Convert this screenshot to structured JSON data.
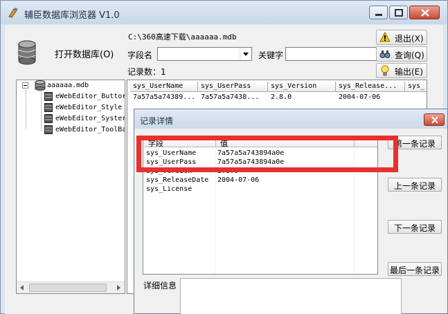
{
  "window": {
    "title": "辅臣数据库浏览器 V1.0"
  },
  "toolbar": {
    "open_db_label": "打开数据库(O)",
    "db_path": "C:\\360高速下载\\aaaaaa.mdb",
    "field_label": "字段名",
    "field_value": "",
    "keyword_label": "关键字",
    "keyword_value": "",
    "record_count_label": "记录数：1",
    "exit_label": "退出(X)",
    "query_label": "查询(Q)",
    "output_label": "输出(E)"
  },
  "tree": {
    "root": "aaaaaa.mdb",
    "tables": [
      "eWebEditor_Button",
      "eWebEditor_Style",
      "eWebEditor_System",
      "eWebEditor_ToolBar"
    ],
    "tables_display": [
      "eWebEditor_Buttor",
      "eWebEditor_Style",
      "eWebEditor_Syster",
      "eWebEditor_ToolBa"
    ]
  },
  "grid": {
    "columns": [
      "sys_UserName",
      "sys_UserPass",
      "sys_Version",
      "sys_Release...",
      "sys_"
    ],
    "rows": [
      [
        "7a57a5a74389...",
        "7a57a5a7438...",
        "2.8.0",
        "2004-07-06",
        ""
      ]
    ]
  },
  "dialog": {
    "title": "记录详情",
    "col_field": "字段",
    "col_value": "值",
    "rows": [
      {
        "field": "sys_UserName",
        "value": "7a57a5a743894a0e"
      },
      {
        "field": "sys_UserPass",
        "value": "7a57a5a743894a0e"
      },
      {
        "field": "sys_Version",
        "value": "2.8.0"
      },
      {
        "field": "sys_ReleaseDate",
        "value": "2004-07-06"
      },
      {
        "field": "sys_License",
        "value": ""
      }
    ],
    "first_label": "第一条记录",
    "prev_label": "上一条记录",
    "next_label": "下一条记录",
    "last_label": "最后一条记录",
    "detail_label": "详细信息",
    "detail_value": ""
  },
  "colors": {
    "highlight": "#e8302c",
    "title_bar": "#dbe6f2",
    "close_button": "#c84a35"
  }
}
